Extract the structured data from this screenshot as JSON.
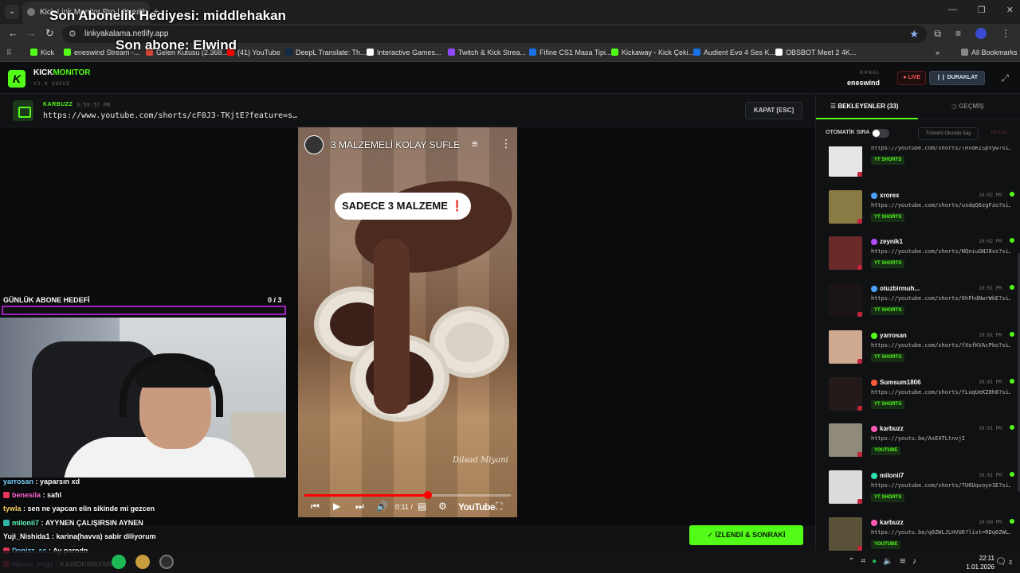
{
  "browser": {
    "tab_title": "Kick Link Monitor Pro | Stream ...",
    "url": "linkyakalama.netlify.app",
    "bookmarks": [
      {
        "label": "Kick",
        "color": "#53fc18"
      },
      {
        "label": "eneswind Stream -...",
        "color": "#53fc18"
      },
      {
        "label": "Gelen Kutusu (2.368...",
        "color": "#d44638"
      },
      {
        "label": "(41) YouTube",
        "color": "#ff0000"
      },
      {
        "label": "DeepL Translate: Th...",
        "color": "#0f2b46"
      },
      {
        "label": "Interactive Games...",
        "color": "#ffffff"
      },
      {
        "label": "Twitch & Kick Strea...",
        "color": "#9147ff"
      },
      {
        "label": "Fifine CS1 Masa Tipi...",
        "color": "#1a73e8"
      },
      {
        "label": "Kickaway - Kick Çeki...",
        "color": "#53fc18"
      },
      {
        "label": "Audient Evo 4 Ses K...",
        "color": "#1a73e8"
      },
      {
        "label": "OBSBOT Meet 2 4K...",
        "color": "#ffffff"
      }
    ],
    "all_bookmarks": "All Bookmarks"
  },
  "overlay": {
    "gift_text": "Son Abonelik Hediyesi: middlehakan",
    "sub_text": "Son abone: Elwind"
  },
  "app": {
    "logo_letter": "K",
    "brand_prefix": "KICK",
    "brand_accent": "MONITOR",
    "version": "V3.0 QUEUE",
    "channel_caption": "KANAL",
    "channel_name": "eneswind",
    "live_label": "● LIVE",
    "stop_label": "❙❙  DURAKLAT",
    "accent_color": "#53fc18"
  },
  "now_playing": {
    "user": "KARBUZZ",
    "time": "9:59:57 PM",
    "url": "https://www.youtube.com/shorts/cF0J3-TKjtE?feature=s…",
    "close_label": "KAPAT [ESC]"
  },
  "video": {
    "title": "3 MALZEMELİ KOLAY SUFLE",
    "caption": "SADECE 3 MALZEME",
    "caption_mark": "❗",
    "watermark": "Dilsad Miyani",
    "time": "0:11 /",
    "brand": "YouTube",
    "progress": 0.6
  },
  "goal": {
    "label": "GÜNLÜK ABONE HEDEFİ",
    "count": "0  / 3",
    "progress": 0
  },
  "chat": [
    {
      "user": "yarrosan",
      "msg": ": yaparsın xd",
      "color": "#7ed3ff",
      "badge": ""
    },
    {
      "user": "benesila",
      "msg": ": safıl",
      "color": "#ff6ad5",
      "badge": "#e8365a"
    },
    {
      "user": "tywla",
      "msg": ": sen ne yapcan elin sikinde mi gezcen",
      "color": "#ffd36a",
      "badge": ""
    },
    {
      "user": "milonii7",
      "msg": ": AYYNEN ÇALIŞIRSIN AYNEN",
      "color": "#6affc0",
      "badge": "#2fb5a8"
    },
    {
      "user": "Yuji_Nishida1",
      "msg": ": karina(havva) sabir diliyorum",
      "color": "#ffffff",
      "badge": ""
    },
    {
      "user": "Denizz_ss",
      "msg": ": Ay parodn",
      "color": "#7ed3ff",
      "badge": "#e8365a"
    },
    {
      "user": "Havva_engz",
      "msg": ": KAMDKWKFMWKD",
      "color": "#c48bff",
      "badge": "#e8365a"
    }
  ],
  "watched_label": "✓  İZLENDİ & SONRAKİ",
  "sidebar": {
    "tab_waiting": "☰  BEKLEYENLER (33)",
    "tab_history": "◷  GEÇMİŞ",
    "auto_label": "OTOMATİK SIRA",
    "mark_all": "Tümünü Okundu Say",
    "clear": "Temizle",
    "queue": [
      {
        "user": "",
        "time": "",
        "url": "https://youtube.com/shorts/lRVdKiSpVyw?si…",
        "tag": "YT SHORTS",
        "icon": "#ffffff",
        "thumb": "#e6e6e6",
        "status": false
      },
      {
        "user": "xrorex",
        "time": "10:02 PM",
        "url": "https://youtube.com/shorts/usdqQ6zgFzo?si…",
        "tag": "YT SHORTS",
        "icon": "#4aa3ff",
        "thumb": "#8a7a44",
        "status": true
      },
      {
        "user": "zeynik1",
        "time": "10:02 PM",
        "url": "https://youtube.com/shorts/NQniuGNJ8ss?si…",
        "tag": "YT SHORTS",
        "icon": "#b44dff",
        "thumb": "#6a2a2a",
        "status": true
      },
      {
        "user": "otuzbirmuh...",
        "time": "10:01 PM",
        "url": "https://youtube.com/shorts/0hFhdNwrWkE?si…",
        "tag": "YT SHORTS",
        "icon": "#4aa3ff",
        "thumb": "#1a1414",
        "status": true
      },
      {
        "user": "yarrosan",
        "time": "10:01 PM",
        "url": "https://youtube.com/shorts/fXofKVAcPko?si…",
        "tag": "YT SHORTS",
        "icon": "#53fc18",
        "thumb": "#cfa890",
        "status": true
      },
      {
        "user": "Sumsum1806",
        "time": "10:01 PM",
        "url": "https://youtube.com/shorts/fLuqUeKZ0h8?si…",
        "tag": "YT SHORTS",
        "icon": "#ff5a3a",
        "thumb": "#241a1a",
        "status": true
      },
      {
        "user": "karbuzz",
        "time": "10:01 PM",
        "url": "https://youtu.be/AxE4TLtnvjI",
        "tag": "YOUTUBE",
        "icon": "#ff5ab5",
        "thumb": "#8f8a7a",
        "status": true
      },
      {
        "user": "milonii7",
        "time": "10:01 PM",
        "url": "https://youtube.com/shorts/7U6Uqvoyn1E?si…",
        "tag": "YT SHORTS",
        "icon": "#2fe0b0",
        "thumb": "#dcdcdc",
        "status": true
      },
      {
        "user": "karbuzz",
        "time": "10:00 PM",
        "url": "https://youtu.be/q0ZWLJLHVU0?list=RDq0ZWL…",
        "tag": "YOUTUBE",
        "icon": "#ff5ab5",
        "thumb": "#5a5238",
        "status": true
      }
    ]
  },
  "taskbar": {
    "time": "22:11",
    "date": "1.01.2026",
    "notif_count": "2"
  }
}
